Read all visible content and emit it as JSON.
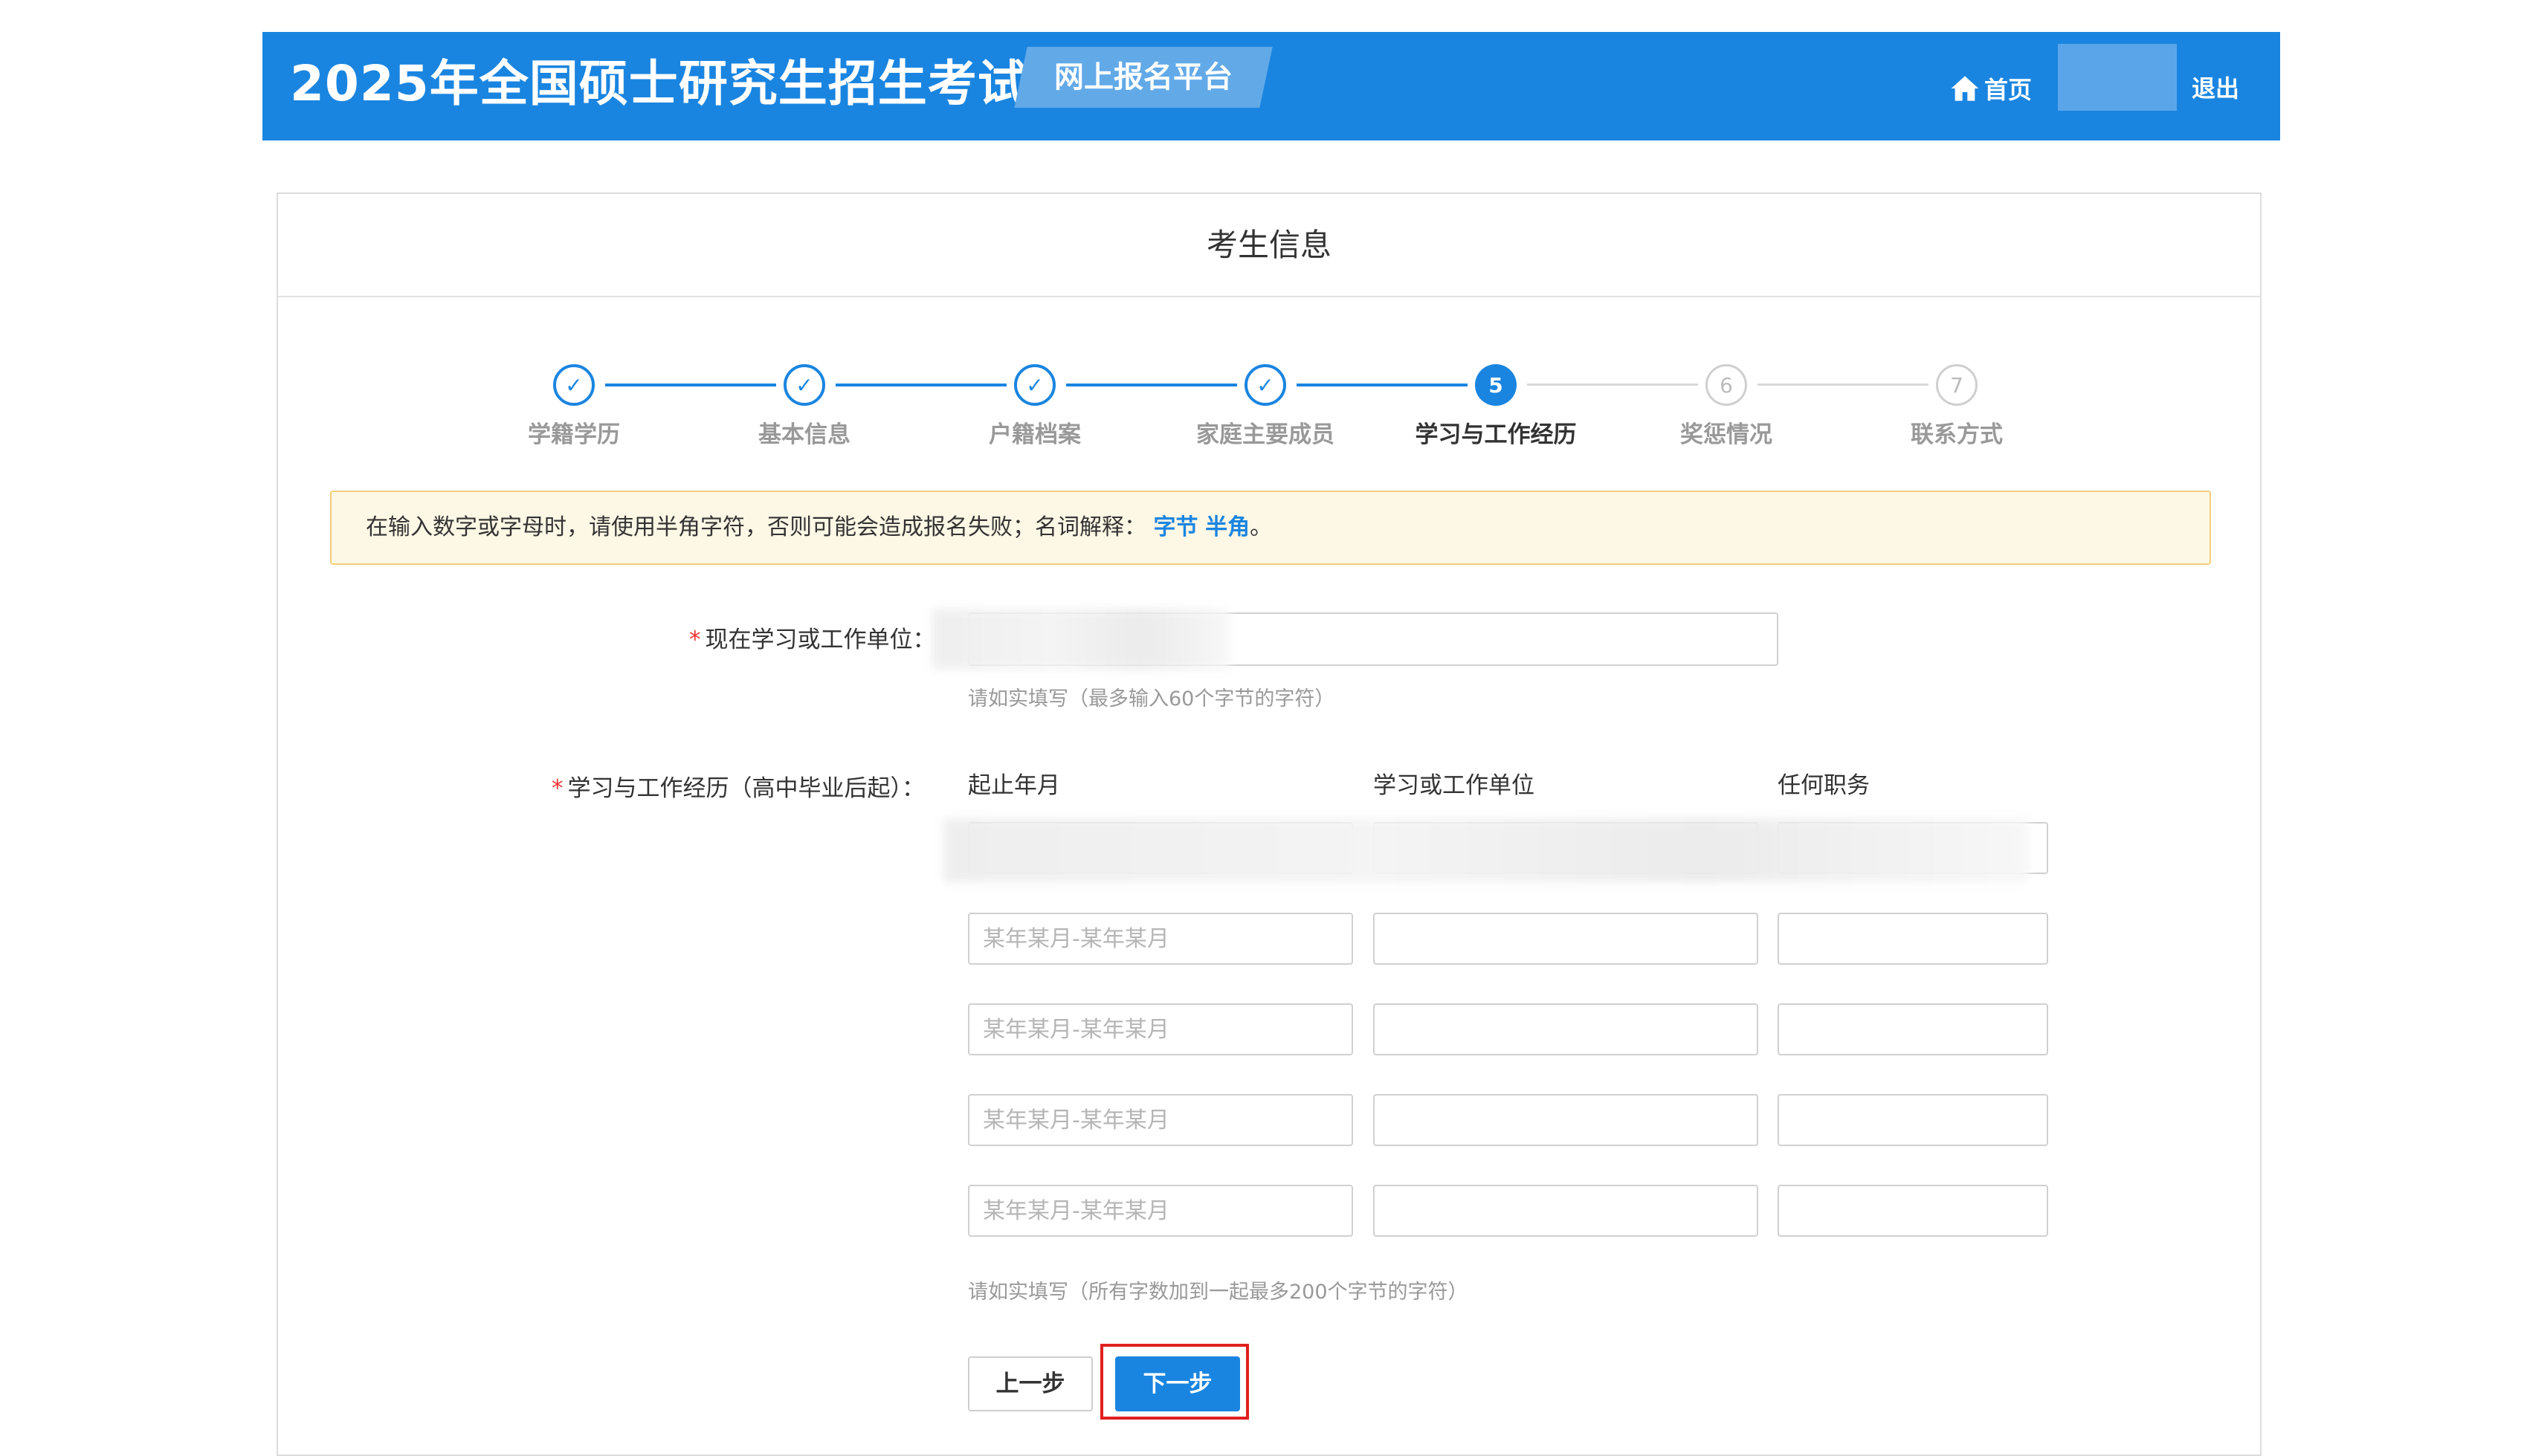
{
  "header": {
    "title": "2025年全国硕士研究生招生考试",
    "platform_badge": "网上报名平台",
    "home_label": "首页",
    "logout_label": "退出"
  },
  "card": {
    "title": "考生信息"
  },
  "steps": [
    {
      "label": "学籍学历",
      "status": "done",
      "marker": "✓"
    },
    {
      "label": "基本信息",
      "status": "done",
      "marker": "✓"
    },
    {
      "label": "户籍档案",
      "status": "done",
      "marker": "✓"
    },
    {
      "label": "家庭主要成员",
      "status": "done",
      "marker": "✓"
    },
    {
      "label": "学习与工作经历",
      "status": "active",
      "marker": "5"
    },
    {
      "label": "奖惩情况",
      "status": "todo",
      "marker": "6"
    },
    {
      "label": "联系方式",
      "status": "todo",
      "marker": "7"
    }
  ],
  "notice": {
    "text": "在输入数字或字母时，请使用半角字符，否则可能会造成报名失败；名词解释：",
    "link_bytes": "字节",
    "link_halfwidth": "半角",
    "suffix": "。"
  },
  "current_unit": {
    "required_mark": "*",
    "label": "现在学习或工作单位：",
    "hint": "请如实填写（最多输入60个字节的字符）"
  },
  "experience": {
    "required_mark": "*",
    "label": "学习与工作经历（高中毕业后起）：",
    "columns": [
      "起止年月",
      "学习或工作单位",
      "任何职务"
    ],
    "row_placeholder": "某年某月-某年某月",
    "hint": "请如实填写（所有字数加到一起最多200个字节的字符）"
  },
  "buttons": {
    "prev": "上一步",
    "next": "下一步"
  },
  "colors": {
    "primary": "#1a85e0",
    "notice_bg": "#fdf7e5",
    "notice_border": "#f3cf7b",
    "required": "#e33333",
    "highlight": "#e02020"
  }
}
